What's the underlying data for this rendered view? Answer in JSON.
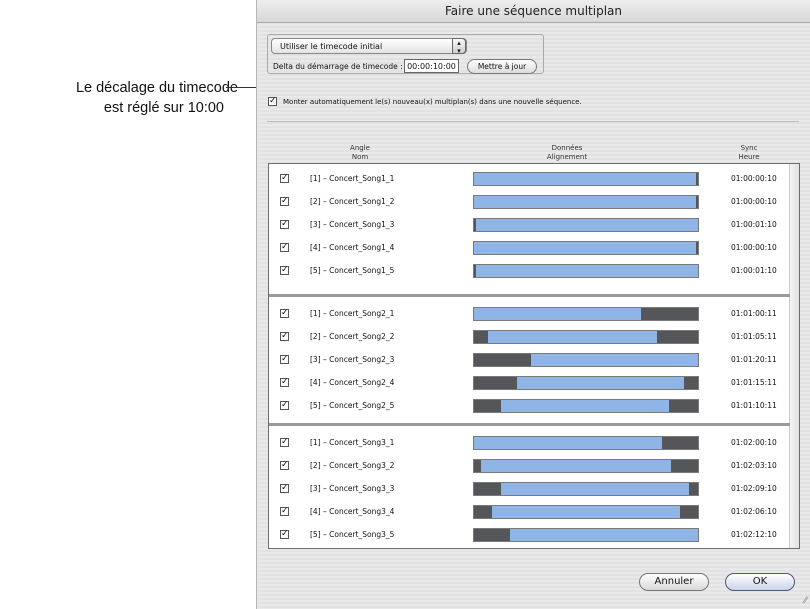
{
  "callout": {
    "line1": "Le décalage du timecode",
    "line2": "est réglé sur 10:00"
  },
  "dialog": {
    "title": "Faire une séquence multiplan",
    "timecode_popup": "Utiliser le timecode initial",
    "delta_label": "Delta du démarrage de timecode :",
    "delta_value": "00:00:10:00",
    "update_button": "Mettre à jour",
    "mount_checkbox_label": "Monter automatiquement le(s) nouveau(x) multiplan(s) dans une nouvelle séquence.",
    "mount_checked": true,
    "columns": {
      "angle": "Angle",
      "name": "Nom",
      "data": "Données",
      "alignment": "Alignement",
      "sync": "Sync",
      "time": "Heure"
    },
    "groups": [
      {
        "rows": [
          {
            "name": "[1] – Concert_Song1_1",
            "sync": "01:00:00:10",
            "fill": [
              0.0,
              0.99
            ],
            "checked": true
          },
          {
            "name": "[2] – Concert_Song1_2",
            "sync": "01:00:00:10",
            "fill": [
              0.0,
              0.99
            ],
            "checked": true
          },
          {
            "name": "[3] – Concert_Song1_3",
            "sync": "01:00:01:10",
            "fill": [
              0.01,
              1.0
            ],
            "checked": true
          },
          {
            "name": "[4] – Concert_Song1_4",
            "sync": "01:00:00:10",
            "fill": [
              0.0,
              0.99
            ],
            "checked": true
          },
          {
            "name": "[5] – Concert_Song1_5",
            "sync": "01:00:01:10",
            "fill": [
              0.01,
              1.0
            ],
            "checked": true
          }
        ]
      },
      {
        "rows": [
          {
            "name": "[1] – Concert_Song2_1",
            "sync": "01:01:00:11",
            "fill": [
              0.0,
              0.75
            ],
            "checked": true
          },
          {
            "name": "[2] – Concert_Song2_2",
            "sync": "01:01:05:11",
            "fill": [
              0.06,
              0.82
            ],
            "checked": true
          },
          {
            "name": "[3] – Concert_Song2_3",
            "sync": "01:01:20:11",
            "fill": [
              0.25,
              1.0
            ],
            "checked": true
          },
          {
            "name": "[4] – Concert_Song2_4",
            "sync": "01:01:15:11",
            "fill": [
              0.19,
              0.94
            ],
            "checked": true
          },
          {
            "name": "[5] – Concert_Song2_5",
            "sync": "01:01:10:11",
            "fill": [
              0.12,
              0.87
            ],
            "checked": true
          }
        ]
      },
      {
        "rows": [
          {
            "name": "[1] – Concert_Song3_1",
            "sync": "01:02:00:10",
            "fill": [
              0.0,
              0.84
            ],
            "checked": true
          },
          {
            "name": "[2] – Concert_Song3_2",
            "sync": "01:02:03:10",
            "fill": [
              0.03,
              0.88
            ],
            "checked": true
          },
          {
            "name": "[3] – Concert_Song3_3",
            "sync": "01:02:09:10",
            "fill": [
              0.12,
              0.96
            ],
            "checked": true
          },
          {
            "name": "[4] – Concert_Song3_4",
            "sync": "01:02:06:10",
            "fill": [
              0.08,
              0.92
            ],
            "checked": true
          },
          {
            "name": "[5] – Concert_Song3_5",
            "sync": "01:02:12:10",
            "fill": [
              0.16,
              1.0
            ],
            "checked": true
          }
        ]
      }
    ],
    "cancel_button": "Annuler",
    "ok_button": "OK"
  },
  "colors": {
    "bar_fill": "#8fb5e6",
    "bar_gap": "#55565a"
  }
}
